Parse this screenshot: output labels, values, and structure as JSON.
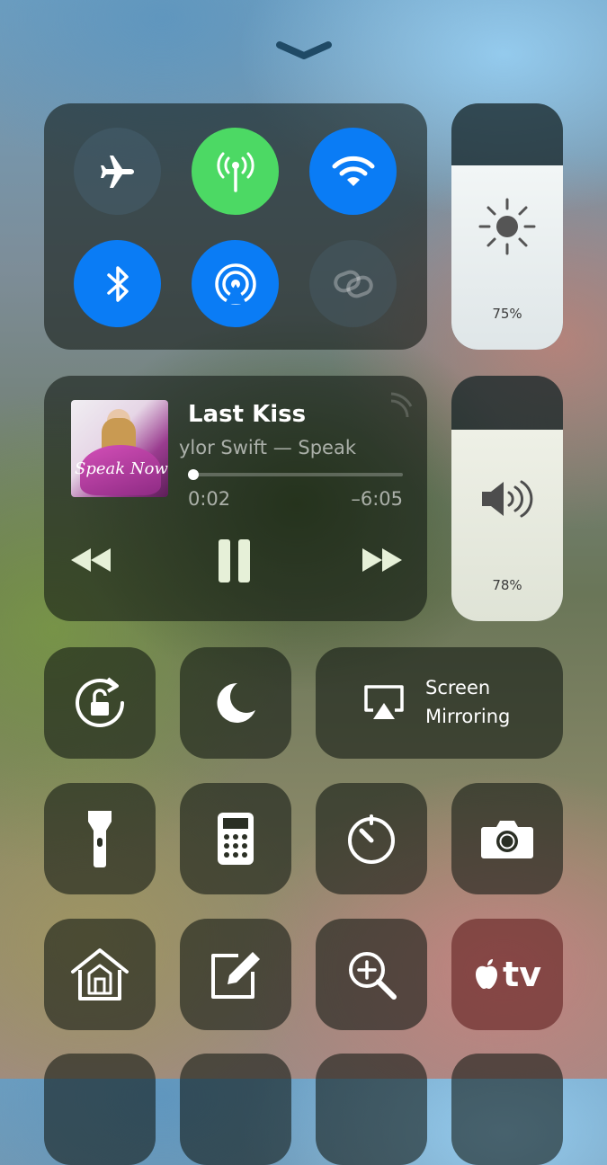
{
  "grabber": {
    "icon": "chevron-down-icon"
  },
  "connectivity": {
    "airplane": {
      "icon": "airplane-icon",
      "state": "off"
    },
    "cellular": {
      "icon": "cellular-antenna-icon",
      "state": "on",
      "color": "#4cd964"
    },
    "wifi": {
      "icon": "wifi-icon",
      "state": "on",
      "color": "#0a7cf5"
    },
    "bluetooth": {
      "icon": "bluetooth-icon",
      "state": "on",
      "color": "#0a7cf5"
    },
    "airdrop": {
      "icon": "airdrop-icon",
      "state": "on",
      "color": "#0a7cf5"
    },
    "hotspot": {
      "icon": "personal-hotspot-icon",
      "state": "disabled"
    }
  },
  "brightness": {
    "value_percent": 75,
    "label": "75%",
    "icon": "sun-icon"
  },
  "now_playing": {
    "title": "Last Kiss",
    "subtitle": "ylor Swift — Speak",
    "elapsed": "0:02",
    "remaining": "–6:05",
    "progress": 0.005,
    "album_art_text": "Speak Now",
    "airplay_icon": "airplay-audio-icon"
  },
  "volume": {
    "value_percent": 78,
    "label": "78%",
    "icon": "speaker-icon"
  },
  "row1": {
    "rotation_lock_icon": "rotation-lock-icon",
    "dnd_icon": "moon-icon",
    "screen_mirroring": {
      "line1": "Screen",
      "line2": "Mirroring",
      "icon": "screen-mirroring-icon"
    }
  },
  "row2": [
    "flashlight-icon",
    "calculator-icon",
    "timer-icon",
    "camera-icon"
  ],
  "row3": [
    "home-icon",
    "notes-icon",
    "magnifier-icon",
    "apple-tv-remote-icon"
  ],
  "apple_tv_label": "tv",
  "colors": {
    "accent_blue": "#0a7cf5",
    "accent_green": "#4cd964"
  }
}
